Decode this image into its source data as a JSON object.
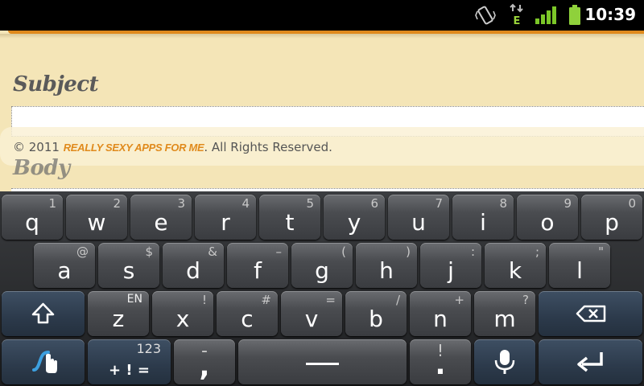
{
  "status_bar": {
    "time": "10:39",
    "network_type": "E",
    "icons": [
      "vibrate-icon",
      "data-transfer-icon",
      "signal-icon",
      "battery-icon"
    ]
  },
  "form": {
    "subject_label": "Subject",
    "subject_value": "",
    "body_label": "Body",
    "footer_prefix": "© 2011 ",
    "footer_brand": "REALLY SEXY APPS FOR ME",
    "footer_suffix": ". All Rights Reserved."
  },
  "keyboard": {
    "row1": [
      {
        "key": "q",
        "hint": "1"
      },
      {
        "key": "w",
        "hint": "2"
      },
      {
        "key": "e",
        "hint": "3"
      },
      {
        "key": "r",
        "hint": "4"
      },
      {
        "key": "t",
        "hint": "5"
      },
      {
        "key": "y",
        "hint": "6"
      },
      {
        "key": "u",
        "hint": "7"
      },
      {
        "key": "i",
        "hint": "8"
      },
      {
        "key": "o",
        "hint": "9"
      },
      {
        "key": "p",
        "hint": "0"
      }
    ],
    "row2": [
      {
        "key": "a",
        "hint": "@"
      },
      {
        "key": "s",
        "hint": "$"
      },
      {
        "key": "d",
        "hint": "&"
      },
      {
        "key": "f",
        "hint": "–"
      },
      {
        "key": "g",
        "hint": "("
      },
      {
        "key": "h",
        "hint": ")"
      },
      {
        "key": "j",
        "hint": ":"
      },
      {
        "key": "k",
        "hint": ";"
      },
      {
        "key": "l",
        "hint": "\""
      }
    ],
    "row3": [
      {
        "key": "z",
        "hint": "EN"
      },
      {
        "key": "x",
        "hint": "!"
      },
      {
        "key": "c",
        "hint": "#"
      },
      {
        "key": "v",
        "hint": "="
      },
      {
        "key": "b",
        "hint": "/"
      },
      {
        "key": "n",
        "hint": "+"
      },
      {
        "key": "m",
        "hint": "?"
      }
    ],
    "symbols_key": {
      "top": "123",
      "bottom": "+ ! ="
    },
    "comma_key": {
      "top": "-",
      "bottom": ","
    },
    "period_key": {
      "top": "!",
      "bottom": "."
    },
    "accent_color": "#3da0e0"
  }
}
